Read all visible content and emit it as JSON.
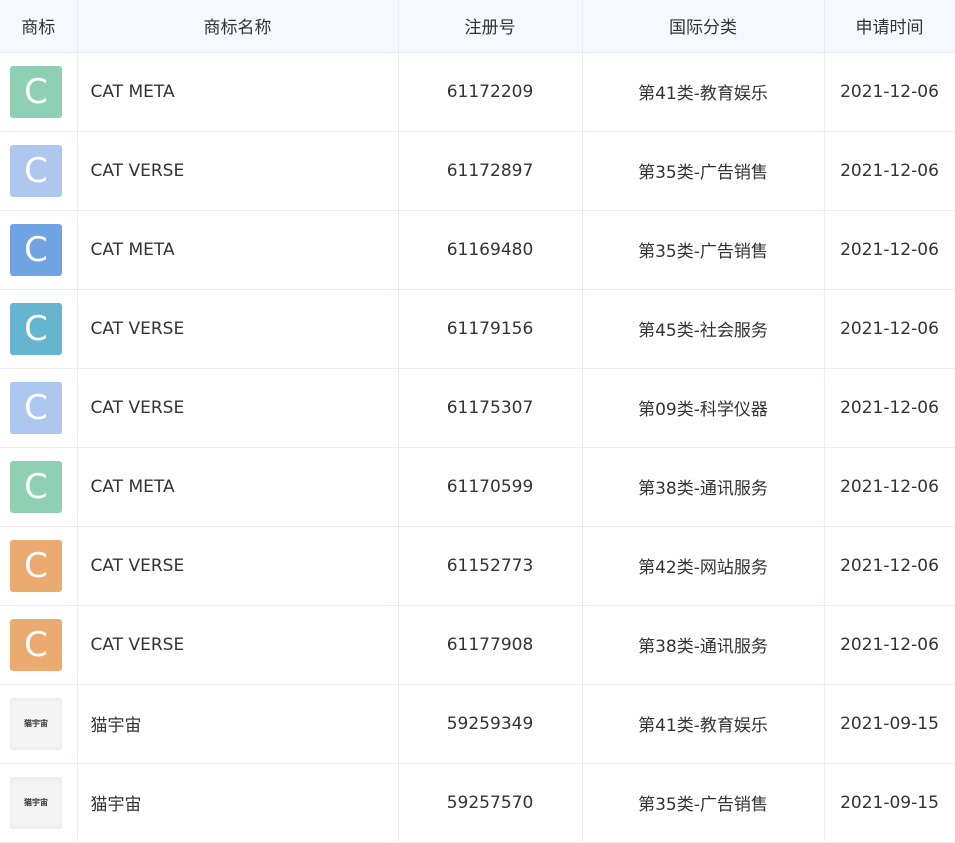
{
  "table": {
    "headers": [
      "商标",
      "商标名称",
      "注册号",
      "国际分类",
      "申请时间"
    ],
    "rows": [
      {
        "logo_letter": "C",
        "logo_color": "#8fd0b4",
        "name": "CAT META",
        "reg_no": "61172209",
        "class": "第41类-教育娱乐",
        "date": "2021-12-06"
      },
      {
        "logo_letter": "C",
        "logo_color": "#aec7ee",
        "name": "CAT VERSE",
        "reg_no": "61172897",
        "class": "第35类-广告销售",
        "date": "2021-12-06"
      },
      {
        "logo_letter": "C",
        "logo_color": "#6fa3e2",
        "name": "CAT META",
        "reg_no": "61169480",
        "class": "第35类-广告销售",
        "date": "2021-12-06"
      },
      {
        "logo_letter": "C",
        "logo_color": "#65b5d0",
        "name": "CAT VERSE",
        "reg_no": "61179156",
        "class": "第45类-社会服务",
        "date": "2021-12-06"
      },
      {
        "logo_letter": "C",
        "logo_color": "#aec7ee",
        "name": "CAT VERSE",
        "reg_no": "61175307",
        "class": "第09类-科学仪器",
        "date": "2021-12-06"
      },
      {
        "logo_letter": "C",
        "logo_color": "#8fd0b4",
        "name": "CAT META",
        "reg_no": "61170599",
        "class": "第38类-通讯服务",
        "date": "2021-12-06"
      },
      {
        "logo_letter": "C",
        "logo_color": "#ebaa70",
        "name": "CAT VERSE",
        "reg_no": "61152773",
        "class": "第42类-网站服务",
        "date": "2021-12-06"
      },
      {
        "logo_letter": "C",
        "logo_color": "#ebaa70",
        "name": "CAT VERSE",
        "reg_no": "61177908",
        "class": "第38类-通讯服务",
        "date": "2021-12-06"
      },
      {
        "logo_image_text": "猫宇宙",
        "name": "猫宇宙",
        "reg_no": "59259349",
        "class": "第41类-教育娱乐",
        "date": "2021-09-15"
      },
      {
        "logo_image_text": "猫宇宙",
        "name": "猫宇宙",
        "reg_no": "59257570",
        "class": "第35类-广告销售",
        "date": "2021-09-15"
      }
    ]
  }
}
